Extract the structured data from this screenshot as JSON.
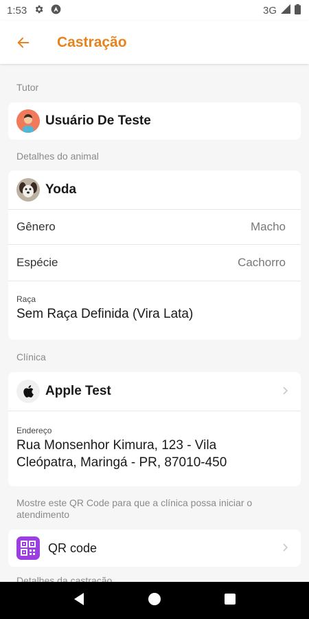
{
  "status_bar": {
    "time": "1:53",
    "network": "3G"
  },
  "app_bar": {
    "title": "Castração"
  },
  "tutor": {
    "section_label": "Tutor",
    "name": "Usuário De Teste"
  },
  "animal": {
    "section_label": "Detalhes do animal",
    "name": "Yoda",
    "gender_label": "Gênero",
    "gender_value": "Macho",
    "species_label": "Espécie",
    "species_value": "Cachorro",
    "breed_label": "Raça",
    "breed_value": "Sem Raça Definida (Vira Lata)"
  },
  "clinic": {
    "section_label": "Clínica",
    "name": "Apple Test",
    "address_label": "Endereço",
    "address_line1": "Rua Monsenhor Kimura, 123 - Vila",
    "address_line2": "Cleópatra, Maringá - PR, 87010-450"
  },
  "qr": {
    "hint_line1": "Mostre este QR Code para que a clínica possa iniciar o",
    "hint_line2": "atendimento",
    "label": "QR code"
  },
  "next_section_label": "Detalhes da castração",
  "colors": {
    "accent": "#e8821e",
    "qr_purple": "#9b3fe0"
  }
}
